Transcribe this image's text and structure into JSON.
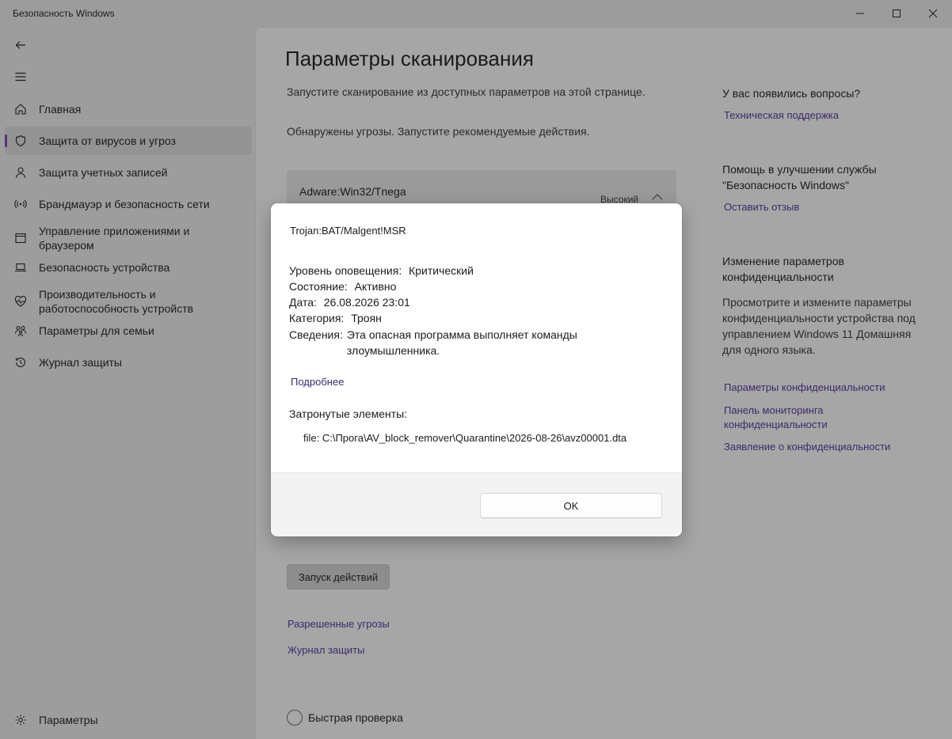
{
  "window": {
    "title": "Безопасность Windows"
  },
  "sidebar": {
    "items": [
      {
        "label": "Главная",
        "icon": "home-icon"
      },
      {
        "label": "Защита от вирусов и угроз",
        "icon": "shield-icon",
        "active": true
      },
      {
        "label": "Защита учетных записей",
        "icon": "person-icon"
      },
      {
        "label": "Брандмауэр и безопасность сети",
        "icon": "wifi-icon"
      },
      {
        "label": "Управление приложениями и браузером",
        "icon": "app-browser-icon"
      },
      {
        "label": "Безопасность устройства",
        "icon": "laptop-icon"
      },
      {
        "label": "Производительность и работоспособность устройств",
        "icon": "heart-icon"
      },
      {
        "label": "Параметры для семьи",
        "icon": "family-icon"
      },
      {
        "label": "Журнал защиты",
        "icon": "history-icon"
      }
    ],
    "settings_label": "Параметры"
  },
  "main": {
    "title": "Параметры сканирования",
    "subtitle": "Запустите сканирование из доступных параметров на этой странице.",
    "threat_message": "Обнаружены угрозы. Запустите рекомендуемые действия.",
    "threat": {
      "name": "Adware:Win32/Tnega",
      "severity": "Высокий"
    },
    "run_button": "Запуск действий",
    "allowed_threats": "Разрешенные угрозы",
    "protection_history": "Журнал защиты",
    "quick_scan": "Быстрая проверка"
  },
  "right": {
    "questions_heading": "У вас появились вопросы?",
    "support_link": "Техническая поддержка",
    "improve_heading": "Помощь в улучшении службы \"Безопасность Windows\"",
    "feedback_link": "Оставить отзыв",
    "privacy_heading": "Изменение параметров конфиденциальности",
    "privacy_text": "Просмотрите и измените параметры конфиденциальности устройства под управлением Windows 11 Домашняя для одного языка.",
    "privacy_settings_link": "Параметры конфиденциальности",
    "privacy_dashboard_link": "Панель мониторинга конфиденциальности",
    "privacy_statement_link": "Заявление о конфиденциальности"
  },
  "dialog": {
    "title": "Trojan:BAT/Malgent!MSR",
    "alert_level_label": "Уровень оповещения:",
    "alert_level_value": "Критический",
    "status_label": "Состояние:",
    "status_value": "Активно",
    "date_label": "Дата:",
    "date_value": "26.08.2026 23:01",
    "category_label": "Категория:",
    "category_value": "Троян",
    "details_label": "Сведения:",
    "details_value": "Эта опасная программа выполняет команды злоумышленника.",
    "more_link": "Подробнее",
    "affected_label": "Затронутые элементы:",
    "file_path": "file: C:\\Прога\\AV_block_remover\\Quarantine\\2026-08-26\\avz00001.dta",
    "ok_button": "OK"
  },
  "colors": {
    "accent": "#5b2d7d",
    "link": "#3b2a6b"
  }
}
